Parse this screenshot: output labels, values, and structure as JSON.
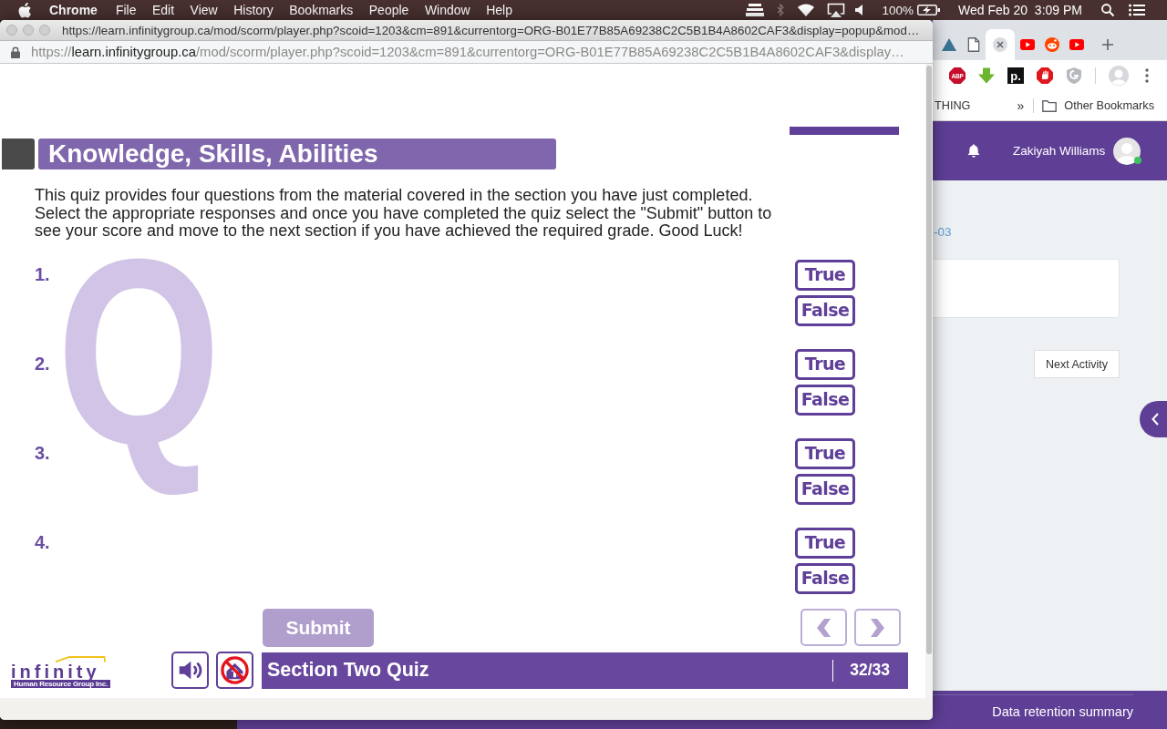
{
  "menu_bar": {
    "app": "Chrome",
    "menus": [
      "File",
      "Edit",
      "View",
      "History",
      "Bookmarks",
      "People",
      "Window",
      "Help"
    ],
    "battery": "100%",
    "clock": "Wed Feb 20  3:09 PM"
  },
  "popup_window": {
    "title": "https://learn.infinitygroup.ca/mod/scorm/player.php?scoid=1203&cm=891&currentorg=ORG-B01E77B85A69238C2C5B1B4A8602CAF3&display=popup&mod…",
    "address": {
      "scheme": "https://",
      "host": "learn.infinitygroup.ca",
      "path": "/mod/scorm/player.php?scoid=1203&cm=891&currentorg=ORG-B01E77B85A69238C2C5B1B4A8602CAF3&display…"
    }
  },
  "quiz": {
    "title": "Knowledge, Skills, Abilities",
    "backdrop_letter": "Q",
    "intro": "This quiz provides four questions from the material covered in the section you have just completed. Select the appropriate responses and once you have completed the quiz select the \"Submit\" button to see your score and move to the next section if you have achieved the required grade. Good Luck!",
    "questions": [
      {
        "number": "1.",
        "options": [
          {
            "label": "True",
            "selected": false
          },
          {
            "label": "False",
            "selected": false
          }
        ]
      },
      {
        "number": "2.",
        "options": [
          {
            "label": "True",
            "selected": false
          },
          {
            "label": "False",
            "selected": false
          }
        ]
      },
      {
        "number": "3.",
        "options": [
          {
            "label": "True",
            "selected": false
          },
          {
            "label": "False",
            "selected": false
          }
        ]
      },
      {
        "number": "4.",
        "options": [
          {
            "label": "True",
            "selected": false
          },
          {
            "label": "False",
            "selected": false
          }
        ]
      }
    ],
    "submit": {
      "label": "Submit",
      "disabled": true
    },
    "nav": [
      {
        "kind": "previous",
        "disabled": true
      },
      {
        "kind": "next",
        "disabled": true
      }
    ],
    "logo": {
      "wordmark": "infinity",
      "tagline": "Human Resource Group Inc."
    },
    "section_title": "Section Two Quiz",
    "page_counter": "32/33"
  },
  "background_window": {
    "tabs": [
      {
        "selected": false
      },
      {
        "selected": false
      },
      {
        "selected": true
      },
      {
        "selected": false
      },
      {
        "selected": false
      },
      {
        "selected": false
      }
    ],
    "extension_labels": [
      "ABP",
      "p."
    ],
    "bookmarks": {
      "cut_item": "THING",
      "overflow": "»",
      "folder": "Other Bookmarks"
    },
    "user": {
      "name": "Zakiyah Williams",
      "online": true
    },
    "link_fragment": "-03",
    "next_button": "Next Activity",
    "footer_link": "Data retention summary"
  }
}
